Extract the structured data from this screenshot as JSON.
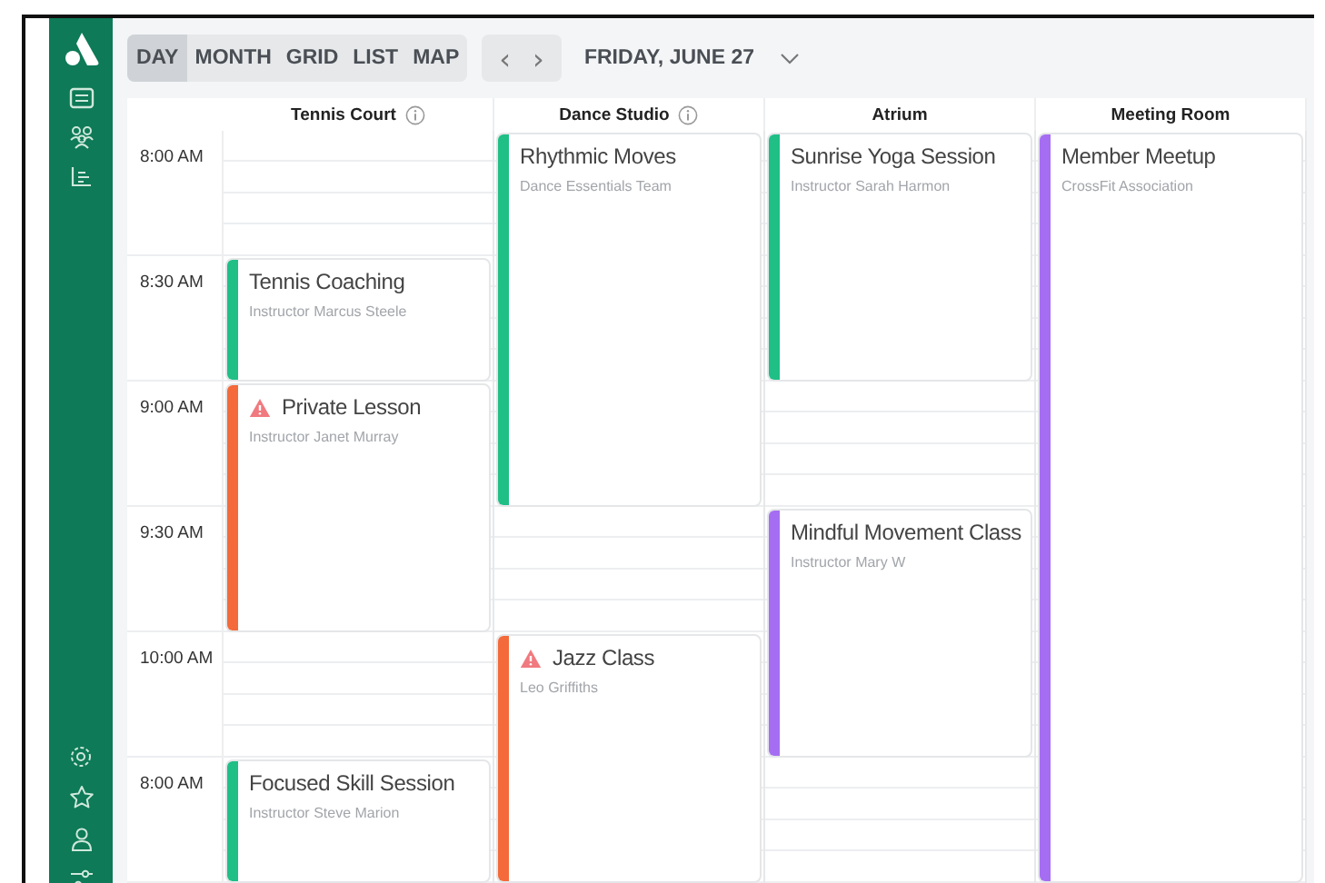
{
  "views": [
    {
      "label": "DAY",
      "selected": true
    },
    {
      "label": "MONTH",
      "selected": false
    },
    {
      "label": "GRID",
      "selected": false
    },
    {
      "label": "LIST",
      "selected": false
    },
    {
      "label": "MAP",
      "selected": false
    }
  ],
  "prev": "‹",
  "next": "›",
  "date": "FRIDAY, JUNE 27",
  "time_labels": [
    "8:00 AM",
    "8:30 AM",
    "9:00 AM",
    "9:30 AM",
    "10:00 AM",
    "8:00 AM"
  ],
  "rooms": [
    {
      "name": "Tennis Court",
      "info": true,
      "slots": [
        {
          "kind": "free"
        },
        {
          "kind": "free"
        },
        {
          "kind": "free"
        },
        {
          "kind": "free"
        },
        {
          "kind": "event",
          "title": "Tennis Coaching",
          "subtitle": "Instructor Marcus Steele",
          "color": "#1fbf86",
          "warning": false
        },
        {
          "kind": "more"
        },
        {
          "kind": "more"
        },
        {
          "kind": "more"
        },
        {
          "kind": "event",
          "title": "Private Lesson",
          "subtitle": "Instructor Janet Murray",
          "color": "#f46a3a",
          "warning": true
        },
        {
          "kind": "more"
        },
        {
          "kind": "more"
        },
        {
          "kind": "more"
        },
        {
          "kind": "more"
        },
        {
          "kind": "more"
        },
        {
          "kind": "more"
        },
        {
          "kind": "more"
        },
        {
          "kind": "free"
        },
        {
          "kind": "free"
        },
        {
          "kind": "free"
        },
        {
          "kind": "free"
        },
        {
          "kind": "event",
          "title": "Focused Skill Session",
          "subtitle": "Instructor Steve Marion",
          "color": "#1fbf86",
          "warning": false
        },
        {
          "kind": "more"
        },
        {
          "kind": "more"
        },
        {
          "kind": "more"
        },
        {
          "kind": "more"
        }
      ]
    },
    {
      "name": "Dance Studio",
      "info": true,
      "slots": [
        {
          "kind": "event",
          "title": "Rhythmic Moves",
          "subtitle": "Dance Essentials Team",
          "color": "#1fbf86",
          "warning": false
        },
        {
          "kind": "more"
        },
        {
          "kind": "more"
        },
        {
          "kind": "more"
        },
        {
          "kind": "more"
        },
        {
          "kind": "more"
        },
        {
          "kind": "more"
        },
        {
          "kind": "more"
        },
        {
          "kind": "more"
        },
        {
          "kind": "more"
        },
        {
          "kind": "more"
        },
        {
          "kind": "more"
        },
        {
          "kind": "free"
        },
        {
          "kind": "free"
        },
        {
          "kind": "free"
        },
        {
          "kind": "free"
        },
        {
          "kind": "event",
          "title": "Jazz Class",
          "subtitle": "Leo Griffiths",
          "color": "#f46a3a",
          "warning": true
        },
        {
          "kind": "more"
        },
        {
          "kind": "more"
        },
        {
          "kind": "more"
        },
        {
          "kind": "more"
        },
        {
          "kind": "more"
        },
        {
          "kind": "more"
        },
        {
          "kind": "more"
        },
        {
          "kind": "more"
        }
      ]
    },
    {
      "name": "Atrium",
      "info": false,
      "slots": [
        {
          "kind": "event",
          "title": "Sunrise Yoga Session",
          "subtitle": "Instructor Sarah Harmon",
          "color": "#1fbf86",
          "warning": false
        },
        {
          "kind": "more"
        },
        {
          "kind": "more"
        },
        {
          "kind": "more"
        },
        {
          "kind": "more"
        },
        {
          "kind": "more"
        },
        {
          "kind": "more"
        },
        {
          "kind": "more"
        },
        {
          "kind": "free"
        },
        {
          "kind": "free"
        },
        {
          "kind": "free"
        },
        {
          "kind": "free"
        },
        {
          "kind": "event",
          "title": "Mindful Movement Class",
          "subtitle": "Instructor Mary W",
          "color": "#a56ef2",
          "warning": false
        },
        {
          "kind": "more"
        },
        {
          "kind": "more"
        },
        {
          "kind": "more"
        },
        {
          "kind": "more"
        },
        {
          "kind": "more"
        },
        {
          "kind": "more"
        },
        {
          "kind": "more"
        },
        {
          "kind": "free"
        },
        {
          "kind": "free"
        },
        {
          "kind": "free"
        },
        {
          "kind": "free"
        }
      ]
    },
    {
      "name": "Meeting Room",
      "info": false,
      "slots": [
        {
          "kind": "event",
          "title": "Member Meetup",
          "subtitle": "CrossFit Association",
          "color": "#a56ef2",
          "warning": false
        },
        {
          "kind": "more"
        },
        {
          "kind": "more"
        },
        {
          "kind": "more"
        },
        {
          "kind": "more"
        },
        {
          "kind": "more"
        },
        {
          "kind": "more"
        },
        {
          "kind": "more"
        },
        {
          "kind": "more"
        },
        {
          "kind": "more"
        },
        {
          "kind": "more"
        },
        {
          "kind": "more"
        },
        {
          "kind": "more"
        },
        {
          "kind": "more"
        },
        {
          "kind": "more"
        },
        {
          "kind": "more"
        },
        {
          "kind": "more"
        },
        {
          "kind": "more"
        },
        {
          "kind": "more"
        },
        {
          "kind": "more"
        },
        {
          "kind": "more"
        },
        {
          "kind": "more"
        },
        {
          "kind": "more"
        },
        {
          "kind": "more"
        },
        {
          "kind": "more"
        }
      ]
    }
  ]
}
